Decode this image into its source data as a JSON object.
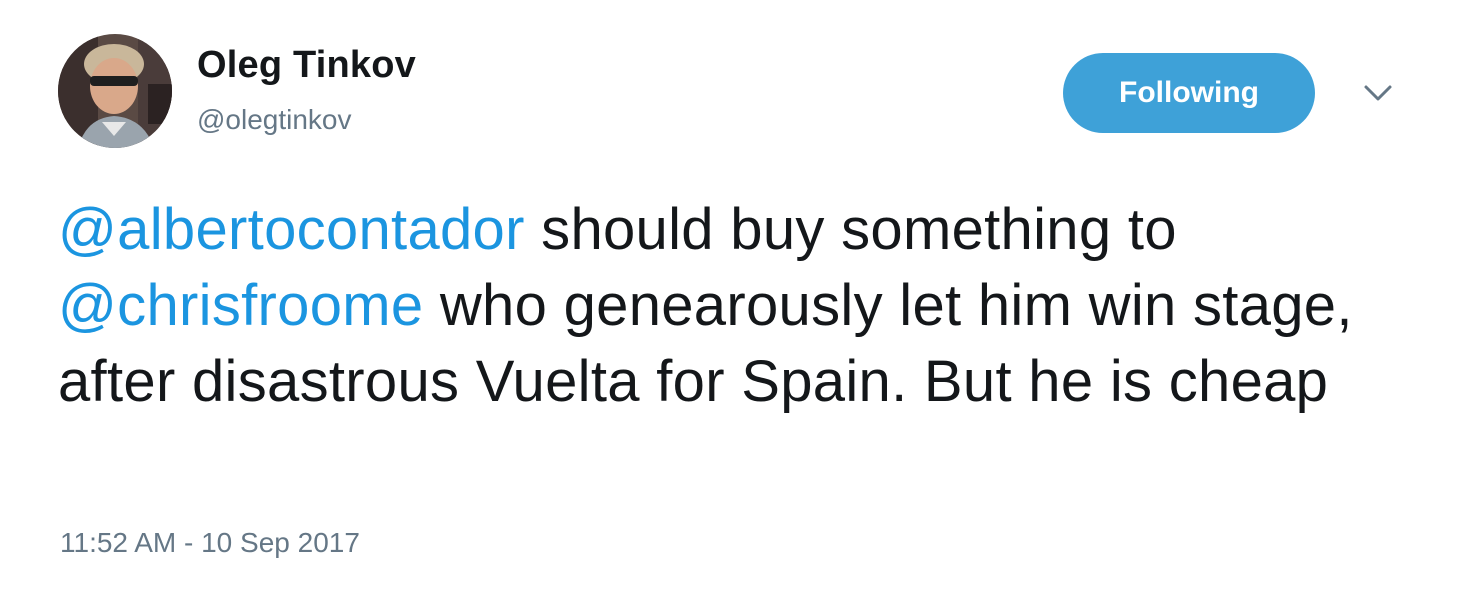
{
  "author": {
    "name": "Oleg Tinkov",
    "handle": "@olegtinkov"
  },
  "follow_button": {
    "label": "Following",
    "color": "#3ea1d8"
  },
  "menu": {
    "icon": "chevron-down-icon"
  },
  "tweet": {
    "mention_1": "@albertocontador",
    "text_1": " should buy something to ",
    "mention_2": "@chrisfroome",
    "text_2": " who genearously let him win stage, after disastrous Vuelta for Spain. But he is cheap"
  },
  "timestamp": "11:52 AM - 10 Sep 2017",
  "colors": {
    "link": "#1b95e0",
    "text": "#14171a",
    "secondary": "#657786"
  }
}
